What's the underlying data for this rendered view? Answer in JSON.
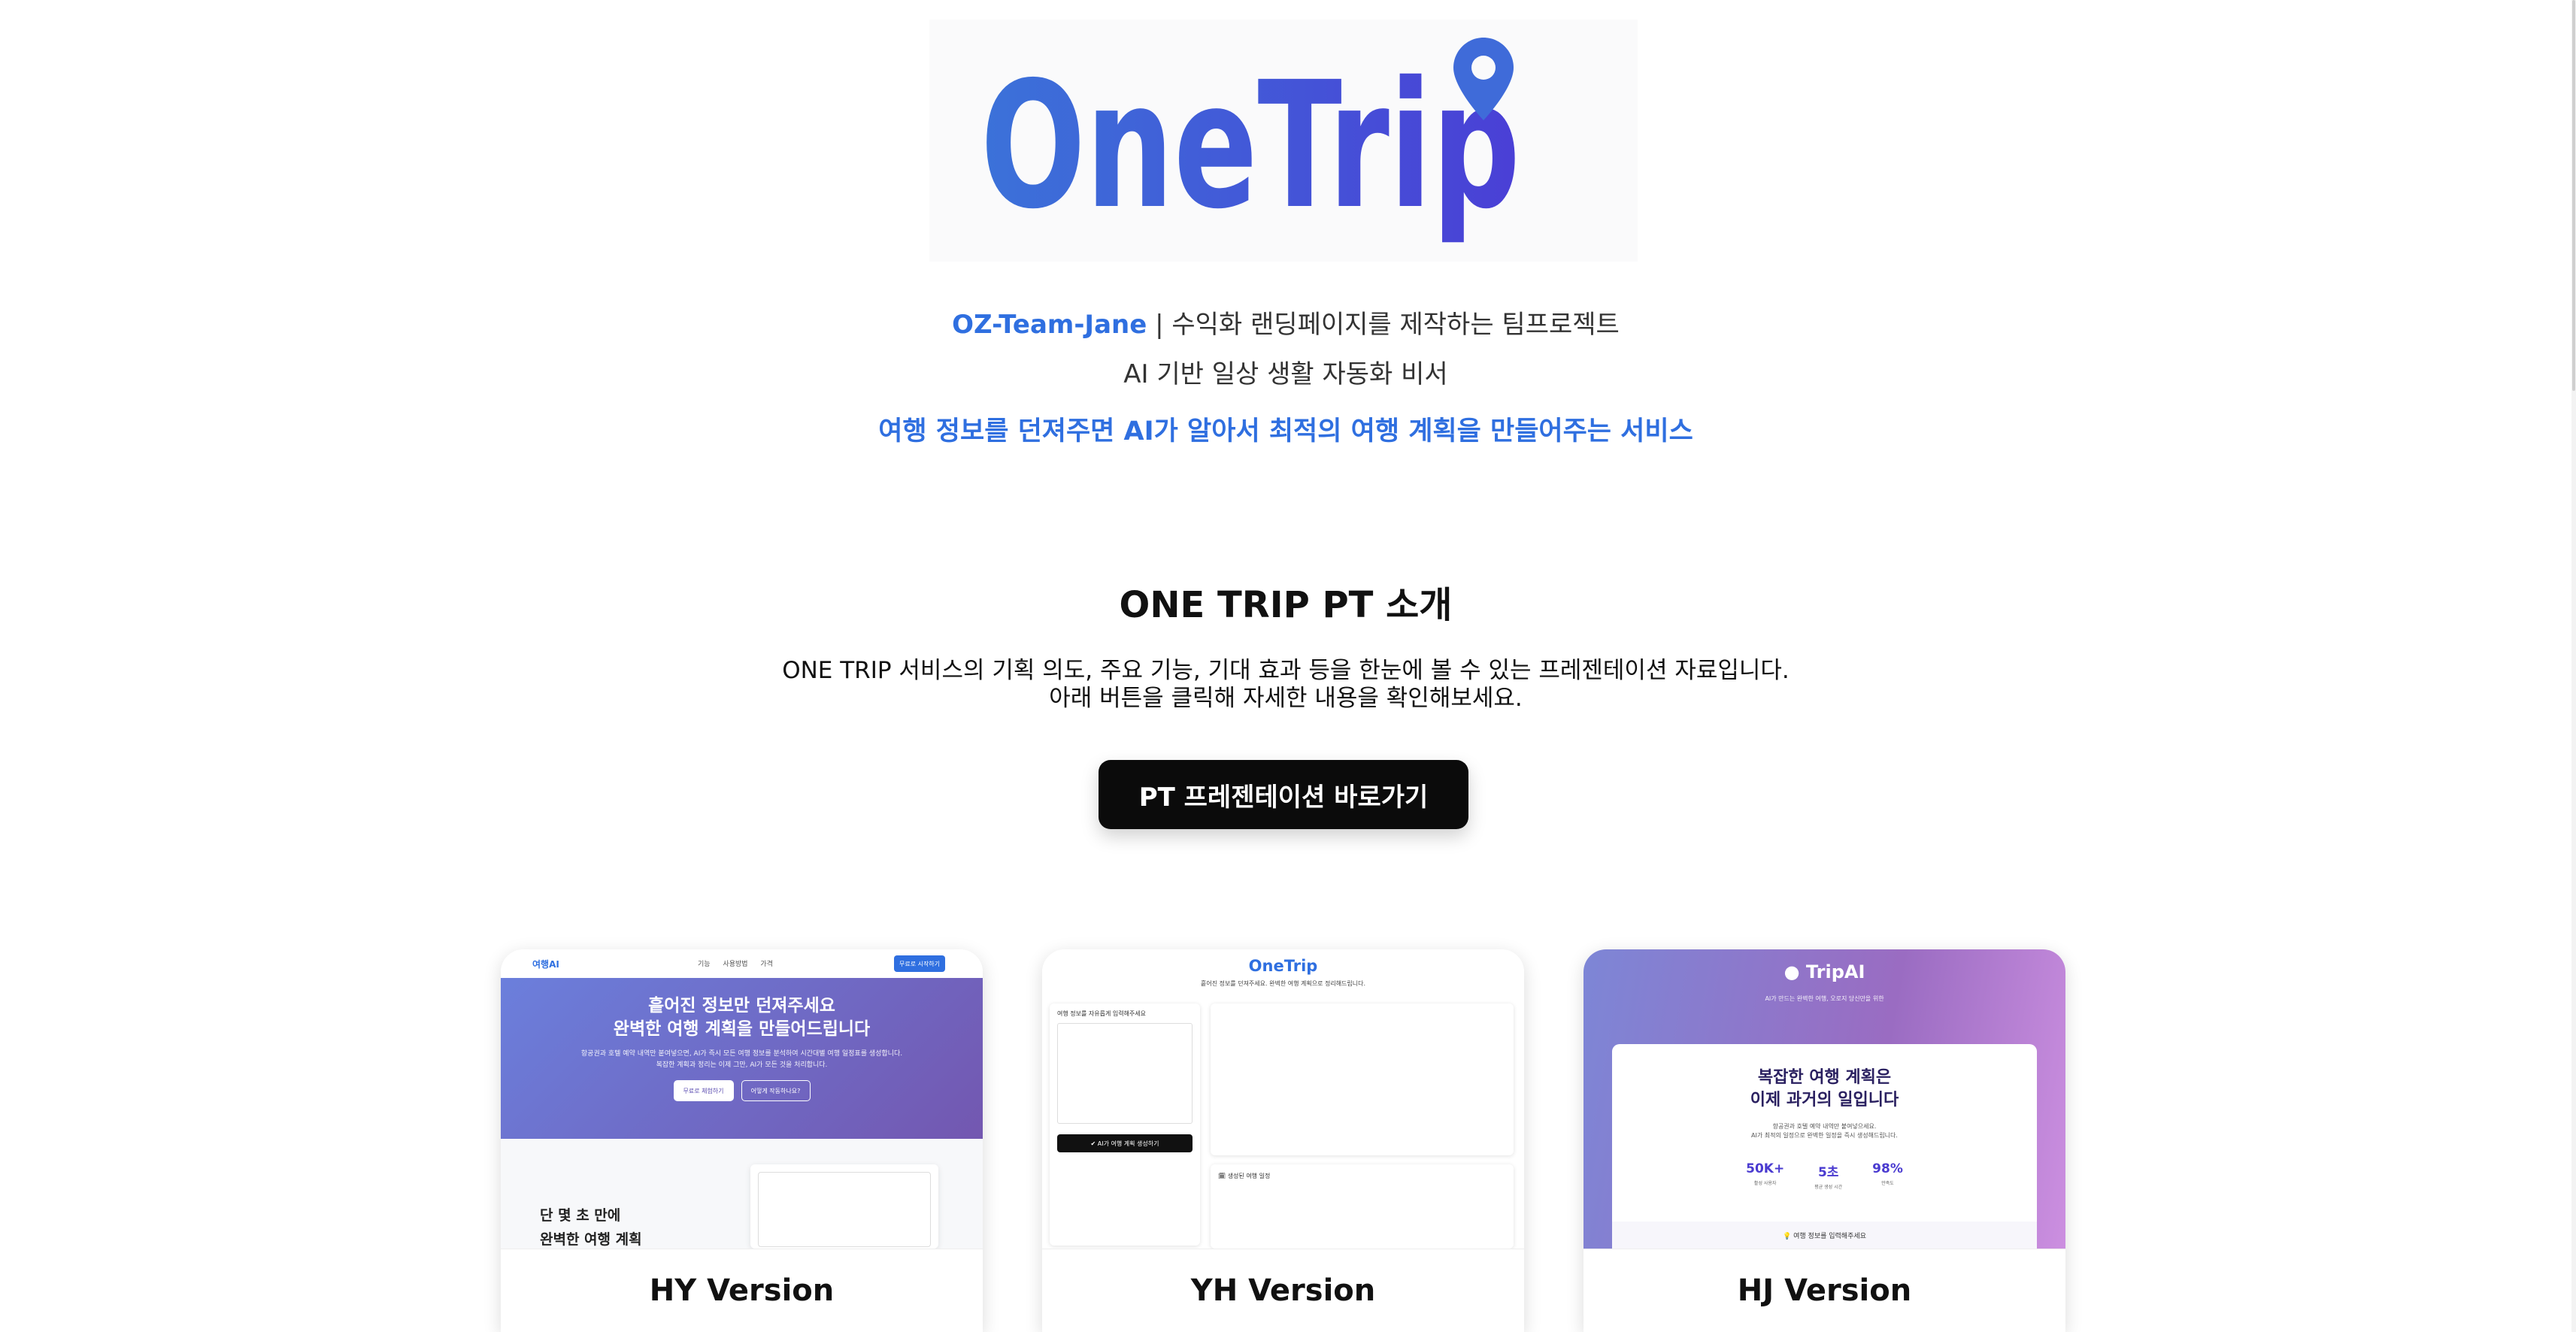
{
  "logo": {
    "text": "OneTrip",
    "colors": [
      "#3b72d9",
      "#4a3fd6"
    ]
  },
  "intro": {
    "team": "OZ-Team-Jane",
    "team_suffix": " | 수익화 랜딩페이지를 제작하는 팀프로젝트",
    "subtitle": "AI 기반 일상 생활 자동화 비서",
    "highlight": "여행 정보를 던져주면 AI가 알아서 최적의 여행 계획을 만들어주는 서비스"
  },
  "pt_section": {
    "title": "ONE TRIP PT 소개",
    "desc1": "ONE TRIP 서비스의 기획 의도, 주요 기능, 기대 효과 등을 한눈에 볼 수 있는 프레젠테이션 자료입니다.",
    "desc2": "아래 버튼을 클릭해 자세한 내용을 확인해보세요.",
    "button": "PT 프레젠테이션 바로가기"
  },
  "versions": [
    {
      "label": "HY Version",
      "preview": {
        "brand": "여행AI",
        "nav": "기능 사용방법 가격",
        "nav_button": "무료로 시작하기",
        "headline1": "흩어진 정보만 던져주세요",
        "headline2": "완벽한 여행 계획을 만들어드립니다",
        "sub1": "항공권과 호텔 예약 내역만 붙여넣으면, AI가 즉시 모든 여행 정보를 분석하여 시간대별 여행 일정표를 생성합니다.",
        "sub2": "복잡한 계획과 정리는 이제 그만, AI가 모든 것을 처리합니다.",
        "btn_primary": "무료로 체험하기",
        "btn_secondary": "어떻게 작동하나요?",
        "lower_title1": "단 몇 초 만에",
        "lower_title2": "완벽한 여행 계획"
      }
    },
    {
      "label": "YH Version",
      "preview": {
        "logo": "OneTrip",
        "sub": "흩어진 정보를 던져주세요. 완벽한 여행 계획으로 정리해드립니다.",
        "left_title": "여행 정보를 자유롭게 입력해주세요",
        "gen_button": "✔ AI가 여행 계획 생성하기",
        "right_bottom_title": "🗓 생성된 여행 일정"
      }
    },
    {
      "label": "HJ Version",
      "preview": {
        "logo": "TripAI",
        "sub": "AI가 만드는 완벽한 여행, 오로지 당신만을 위한",
        "headline1": "복잡한 여행 계획은",
        "headline2": "이제 과거의 일입니다",
        "desc1": "항공권과 호텔 예약 내역만 붙여넣으세요.",
        "desc2": "AI가 최적의 일정으로 완벽한 일정을 즉시 생성해드립니다.",
        "stats": [
          {
            "value": "50K+",
            "label": "활성 사용자"
          },
          {
            "value": "5초",
            "label": "평균 생성 시간"
          },
          {
            "value": "98%",
            "label": "만족도"
          }
        ],
        "bottom": "여행 정보를 입력해주세요"
      }
    }
  ]
}
